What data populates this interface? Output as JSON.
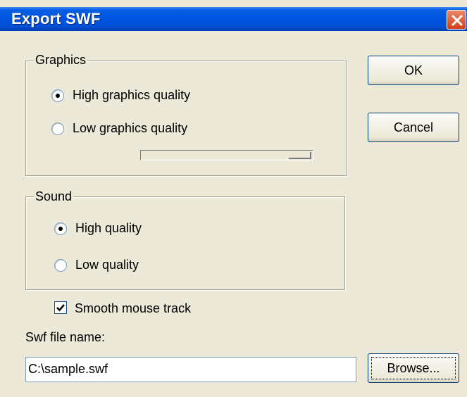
{
  "window": {
    "title": "Export SWF"
  },
  "graphics": {
    "legend": "Graphics",
    "options": [
      {
        "label": "High graphics quality",
        "checked": true
      },
      {
        "label": "Low graphics quality",
        "checked": false
      }
    ],
    "slider_level": 0.9
  },
  "sound": {
    "legend": "Sound",
    "options": [
      {
        "label": "High quality",
        "checked": true
      },
      {
        "label": "Low quality",
        "checked": false
      }
    ]
  },
  "smooth_mouse": {
    "label": "Smooth mouse track",
    "checked": true
  },
  "file": {
    "label": "Swf file name:",
    "value": "C:\\sample.swf"
  },
  "buttons": {
    "ok": "OK",
    "cancel": "Cancel",
    "browse": "Browse..."
  },
  "icons": {
    "close": "close-icon"
  }
}
